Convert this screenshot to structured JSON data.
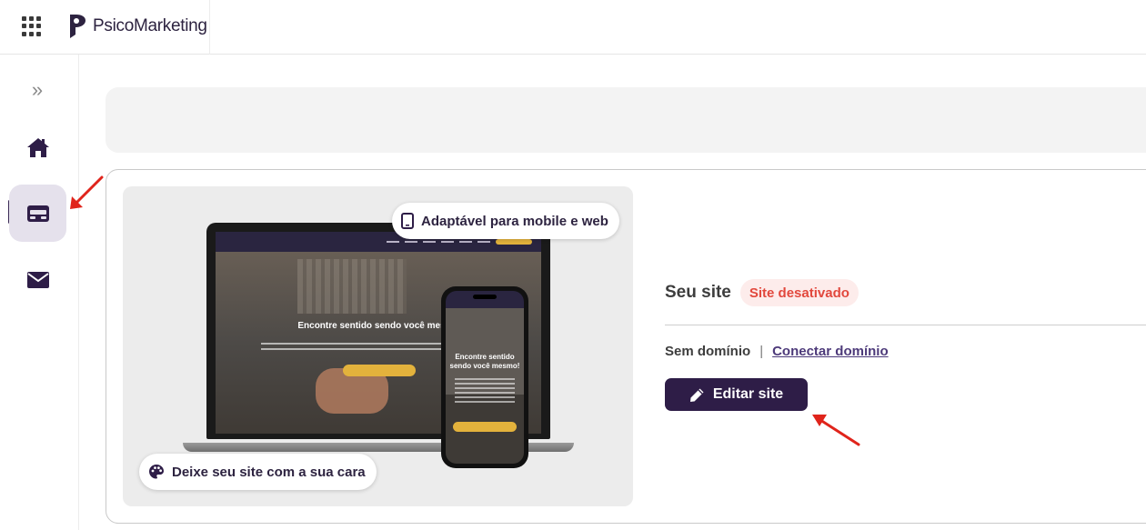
{
  "app": {
    "name": "PsicoMarketing"
  },
  "sidebar": {
    "items": [
      {
        "name": "home",
        "icon": "home-icon"
      },
      {
        "name": "site",
        "icon": "website-card-icon",
        "active": true
      },
      {
        "name": "mail",
        "icon": "mail-icon"
      }
    ]
  },
  "site_card": {
    "preview": {
      "badge_top": "Adaptável para mobile e web",
      "badge_bottom": "Deixe seu site com a sua cara",
      "laptop_headline": "Encontre sentido sendo você mesmo",
      "phone_headline": "Encontre sentido sendo você mesmo!"
    },
    "title": "Seu site",
    "status": "Site desativado",
    "domain_status": "Sem domínio",
    "separator": "|",
    "connect_domain": "Conectar domínio",
    "edit_button": "Editar site"
  },
  "colors": {
    "primary": "#2e1d47",
    "status_text": "#e2483d",
    "status_bg": "#fdeceb",
    "annotation_arrow": "#e0241b"
  }
}
